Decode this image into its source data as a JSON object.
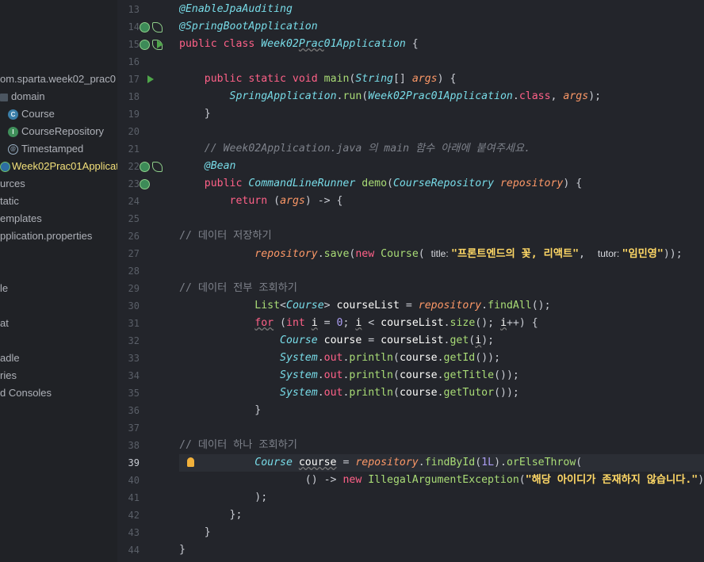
{
  "sidebar": {
    "items": [
      {
        "label": "om.sparta.week02_prac0",
        "kind": "package"
      },
      {
        "label": "domain",
        "kind": "folder"
      },
      {
        "label": "Course",
        "kind": "class",
        "badge": "C"
      },
      {
        "label": "CourseRepository",
        "kind": "interface",
        "badge": "I"
      },
      {
        "label": "Timestamped",
        "kind": "annotation",
        "badge": "@"
      },
      {
        "label": "Week02Prac01Applicat",
        "kind": "spring-class",
        "selected": true
      },
      {
        "label": "urces",
        "kind": "folder"
      },
      {
        "label": "tatic",
        "kind": "folder"
      },
      {
        "label": "emplates",
        "kind": "folder"
      },
      {
        "label": "pplication.properties",
        "kind": "file"
      },
      {
        "label": "le",
        "kind": "file"
      },
      {
        "label": "at",
        "kind": "file"
      },
      {
        "label": "adle",
        "kind": "folder"
      },
      {
        "label": "ries",
        "kind": "folder"
      },
      {
        "label": "d Consoles",
        "kind": "folder"
      }
    ]
  },
  "editor": {
    "active_line": "39",
    "lines": [
      {
        "n": "13",
        "tokens": [
          [
            "ann",
            "@EnableJpaAuditing"
          ]
        ]
      },
      {
        "n": "14",
        "tokens": [
          [
            "ann",
            "@SpringBootApplication"
          ]
        ]
      },
      {
        "n": "15",
        "tokens": [
          [
            "kw",
            "public class "
          ],
          [
            "typ",
            "Week02"
          ],
          [
            "typ under",
            "Prac"
          ],
          [
            "typ",
            "01Application"
          ],
          [
            "op",
            " {"
          ]
        ]
      },
      {
        "n": "16",
        "tokens": []
      },
      {
        "n": "17",
        "tokens": [
          [
            "op",
            "    "
          ],
          [
            "kw",
            "public static void "
          ],
          [
            "fn",
            "main"
          ],
          [
            "op",
            "("
          ],
          [
            "typ",
            "String"
          ],
          [
            "op",
            "[] "
          ],
          [
            "param",
            "args"
          ],
          [
            "op",
            ") {"
          ]
        ]
      },
      {
        "n": "18",
        "tokens": [
          [
            "op",
            "        "
          ],
          [
            "typ",
            "SpringApplication"
          ],
          [
            "op",
            "."
          ],
          [
            "fn",
            "run"
          ],
          [
            "op",
            "("
          ],
          [
            "typ",
            "Week02Prac01Application"
          ],
          [
            "op",
            "."
          ],
          [
            "kw",
            "class"
          ],
          [
            "op",
            ", "
          ],
          [
            "param",
            "args"
          ],
          [
            "op",
            ");"
          ]
        ]
      },
      {
        "n": "19",
        "tokens": [
          [
            "op",
            "    }"
          ]
        ]
      },
      {
        "n": "20",
        "tokens": []
      },
      {
        "n": "21",
        "tokens": [
          [
            "op",
            "    "
          ],
          [
            "cm",
            "// Week02Application.java 의 main 함수 아래에 붙여주세요."
          ]
        ]
      },
      {
        "n": "22",
        "tokens": [
          [
            "op",
            "    "
          ],
          [
            "ann",
            "@Bean"
          ]
        ]
      },
      {
        "n": "23",
        "tokens": [
          [
            "op",
            "    "
          ],
          [
            "kw",
            "public "
          ],
          [
            "typ",
            "CommandLineRunner "
          ],
          [
            "fn",
            "demo"
          ],
          [
            "op",
            "("
          ],
          [
            "typ",
            "CourseRepository "
          ],
          [
            "param",
            "repository"
          ],
          [
            "op",
            ") {"
          ]
        ]
      },
      {
        "n": "24",
        "tokens": [
          [
            "op",
            "        "
          ],
          [
            "kw",
            "return "
          ],
          [
            "op",
            "("
          ],
          [
            "param",
            "args"
          ],
          [
            "op",
            ") -> {"
          ]
        ]
      },
      {
        "n": "25",
        "tokens": []
      },
      {
        "n": "26",
        "tokens": [
          [
            "cmk",
            "// 데이터 저장하기"
          ]
        ]
      },
      {
        "n": "27",
        "tokens": [
          [
            "op",
            "            "
          ],
          [
            "param",
            "repository"
          ],
          [
            "op",
            "."
          ],
          [
            "fn",
            "save"
          ],
          [
            "op",
            "("
          ],
          [
            "kw",
            "new "
          ],
          [
            "fn",
            "Course"
          ],
          [
            "op",
            "( "
          ],
          [
            "hint",
            "title: "
          ],
          [
            "str",
            "\"프론트엔드의 꽃, 리액트\""
          ],
          [
            "op",
            ",  "
          ],
          [
            "hint",
            "tutor: "
          ],
          [
            "str",
            "\"임민영\""
          ],
          [
            "op",
            "));"
          ]
        ]
      },
      {
        "n": "28",
        "tokens": []
      },
      {
        "n": "29",
        "tokens": [
          [
            "cmk",
            "// 데이터 전부 조회하기"
          ]
        ]
      },
      {
        "n": "30",
        "tokens": [
          [
            "op",
            "            "
          ],
          [
            "fn",
            "List"
          ],
          [
            "op",
            "<"
          ],
          [
            "typ",
            "Course"
          ],
          [
            "op",
            "> "
          ],
          [
            "var",
            "courseList"
          ],
          [
            "op",
            " = "
          ],
          [
            "param",
            "repository"
          ],
          [
            "op",
            "."
          ],
          [
            "fn",
            "findAll"
          ],
          [
            "op",
            "();"
          ]
        ]
      },
      {
        "n": "31",
        "tokens": [
          [
            "op",
            "            "
          ],
          [
            "kw under",
            "for"
          ],
          [
            "op",
            " ("
          ],
          [
            "kw",
            "int "
          ],
          [
            "var under",
            "i"
          ],
          [
            "op",
            " = "
          ],
          [
            "num",
            "0"
          ],
          [
            "op",
            "; "
          ],
          [
            "var under",
            "i"
          ],
          [
            "op",
            " < "
          ],
          [
            "var",
            "courseList"
          ],
          [
            "op",
            "."
          ],
          [
            "fn",
            "size"
          ],
          [
            "op",
            "(); "
          ],
          [
            "var under",
            "i"
          ],
          [
            "op",
            "++) {"
          ]
        ]
      },
      {
        "n": "32",
        "tokens": [
          [
            "op",
            "                "
          ],
          [
            "typ",
            "Course "
          ],
          [
            "var",
            "course"
          ],
          [
            "op",
            " = "
          ],
          [
            "var",
            "courseList"
          ],
          [
            "op",
            "."
          ],
          [
            "fn",
            "get"
          ],
          [
            "op",
            "("
          ],
          [
            "var under",
            "i"
          ],
          [
            "op",
            ");"
          ]
        ]
      },
      {
        "n": "33",
        "tokens": [
          [
            "op",
            "                "
          ],
          [
            "typ",
            "System"
          ],
          [
            "op",
            "."
          ],
          [
            "kw",
            "out"
          ],
          [
            "op",
            "."
          ],
          [
            "fn",
            "println"
          ],
          [
            "op",
            "("
          ],
          [
            "var",
            "course"
          ],
          [
            "op",
            "."
          ],
          [
            "fn",
            "getId"
          ],
          [
            "op",
            "());"
          ]
        ]
      },
      {
        "n": "34",
        "tokens": [
          [
            "op",
            "                "
          ],
          [
            "typ",
            "System"
          ],
          [
            "op",
            "."
          ],
          [
            "kw",
            "out"
          ],
          [
            "op",
            "."
          ],
          [
            "fn",
            "println"
          ],
          [
            "op",
            "("
          ],
          [
            "var",
            "course"
          ],
          [
            "op",
            "."
          ],
          [
            "fn",
            "getTitle"
          ],
          [
            "op",
            "());"
          ]
        ]
      },
      {
        "n": "35",
        "tokens": [
          [
            "op",
            "                "
          ],
          [
            "typ",
            "System"
          ],
          [
            "op",
            "."
          ],
          [
            "kw",
            "out"
          ],
          [
            "op",
            "."
          ],
          [
            "fn",
            "println"
          ],
          [
            "op",
            "("
          ],
          [
            "var",
            "course"
          ],
          [
            "op",
            "."
          ],
          [
            "fn",
            "getTutor"
          ],
          [
            "op",
            "());"
          ]
        ]
      },
      {
        "n": "36",
        "tokens": [
          [
            "op",
            "            }"
          ]
        ]
      },
      {
        "n": "37",
        "tokens": []
      },
      {
        "n": "38",
        "tokens": [
          [
            "cmk",
            "// 데이터 하나 조회하기"
          ]
        ]
      },
      {
        "n": "39",
        "tokens": [
          [
            "op",
            "            "
          ],
          [
            "typ",
            "Course "
          ],
          [
            "var under",
            "course"
          ],
          [
            "op",
            " = "
          ],
          [
            "param",
            "repository"
          ],
          [
            "op",
            "."
          ],
          [
            "fn",
            "findById"
          ],
          [
            "op",
            "("
          ],
          [
            "num",
            "1L"
          ],
          [
            "op",
            ")."
          ],
          [
            "fn",
            "orElseThrow"
          ],
          [
            "op",
            "("
          ]
        ]
      },
      {
        "n": "40",
        "tokens": [
          [
            "op",
            "                    () -> "
          ],
          [
            "kw",
            "new "
          ],
          [
            "fn",
            "IllegalArgumentException"
          ],
          [
            "op",
            "("
          ],
          [
            "str",
            "\"해당 아이디가 존재하지 않습니다.\""
          ],
          [
            "op",
            ")"
          ]
        ]
      },
      {
        "n": "41",
        "tokens": [
          [
            "op",
            "            );"
          ]
        ]
      },
      {
        "n": "42",
        "tokens": [
          [
            "op",
            "        };"
          ]
        ]
      },
      {
        "n": "43",
        "tokens": [
          [
            "op",
            "    }"
          ]
        ]
      },
      {
        "n": "44",
        "tokens": [
          [
            "op",
            "}"
          ]
        ]
      }
    ]
  },
  "gutter_icons": [
    {
      "line": "14",
      "icons": [
        "bean-icon",
        "leaf-icon"
      ]
    },
    {
      "line": "15",
      "icons": [
        "bean-icon",
        "leaf-icon",
        "run-icon"
      ]
    },
    {
      "line": "17",
      "icons": [
        "run-icon"
      ]
    },
    {
      "line": "22",
      "icons": [
        "bean-icon",
        "leaf-icon"
      ]
    },
    {
      "line": "23",
      "icons": [
        "bean-icon"
      ]
    },
    {
      "line": "39",
      "icons": [
        "intention-bulb-icon"
      ]
    }
  ]
}
